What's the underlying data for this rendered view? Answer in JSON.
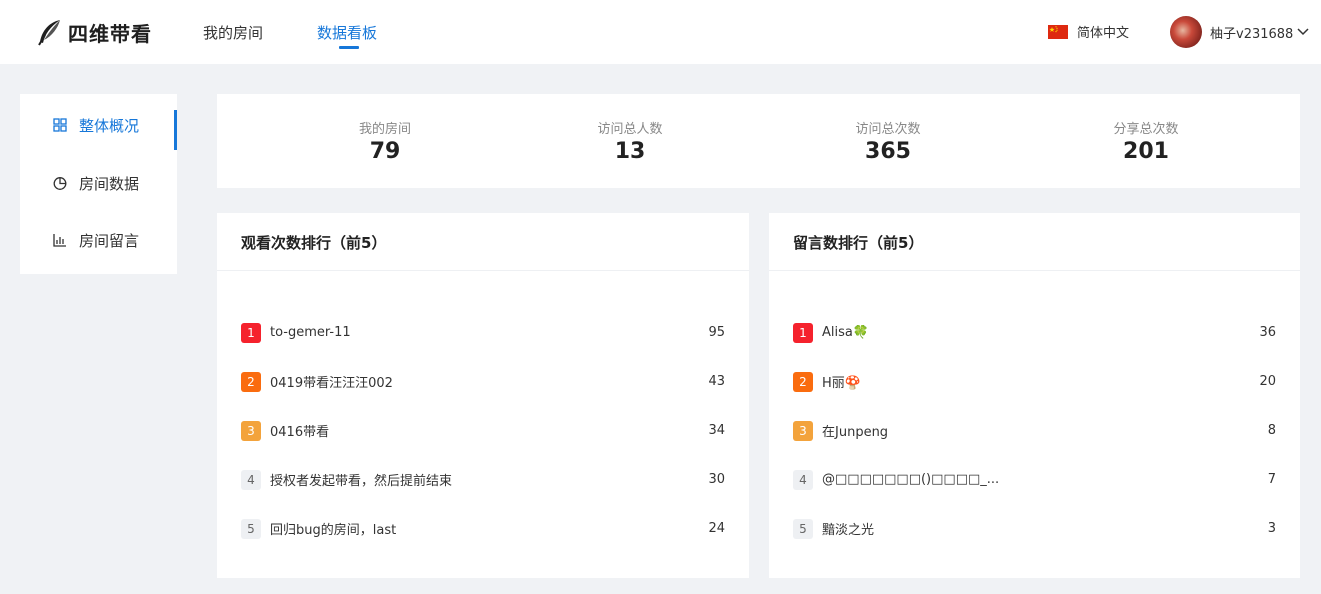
{
  "header": {
    "logo_text": "四维带看",
    "nav": [
      "我的房间",
      "数据看板"
    ],
    "active_nav": "数据看板",
    "language": "简体中文",
    "user_name": "柚子v231688",
    "chevron": "chevron-down-icon"
  },
  "sidebar": {
    "items": [
      {
        "label": "整体概况",
        "icon": "grid-icon",
        "active": true
      },
      {
        "label": "房间数据",
        "icon": "pie-chart-icon",
        "active": false
      },
      {
        "label": "房间留言",
        "icon": "bar-chart-icon",
        "active": false
      }
    ]
  },
  "stats": [
    {
      "label": "我的房间",
      "value": "79"
    },
    {
      "label": "访问总人数",
      "value": "13"
    },
    {
      "label": "访问总次数",
      "value": "365"
    },
    {
      "label": "分享总次数",
      "value": "201"
    }
  ],
  "views_ranking": {
    "title": "观看次数排行（前5）",
    "rows": [
      {
        "rank": "1",
        "name": "to-gemer-11",
        "value": "95"
      },
      {
        "rank": "2",
        "name": "0419带看汪汪汪002",
        "value": "43"
      },
      {
        "rank": "3",
        "name": "0416带看",
        "value": "34"
      },
      {
        "rank": "4",
        "name": "授权者发起带看，然后提前结束",
        "value": "30"
      },
      {
        "rank": "5",
        "name": "回归bug的房间，last",
        "value": "24"
      }
    ]
  },
  "comments_ranking": {
    "title": "留言数排行（前5）",
    "rows": [
      {
        "rank": "1",
        "name": "Alisa🍀",
        "value": "36"
      },
      {
        "rank": "2",
        "name": "H丽🍄",
        "value": "20"
      },
      {
        "rank": "3",
        "name": "在Junpeng",
        "value": "8"
      },
      {
        "rank": "4",
        "name": "@□□□□□□□()□□□□_...",
        "value": "7"
      },
      {
        "rank": "5",
        "name": "黯淡之光",
        "value": "3"
      }
    ]
  },
  "colors": {
    "accent": "#1677d9",
    "rank1": "#f5222d",
    "rank2": "#fa6c0f",
    "rank3": "#f3a33c",
    "rank_other_bg": "#eef0f3",
    "rank_other_text": "#666666"
  }
}
